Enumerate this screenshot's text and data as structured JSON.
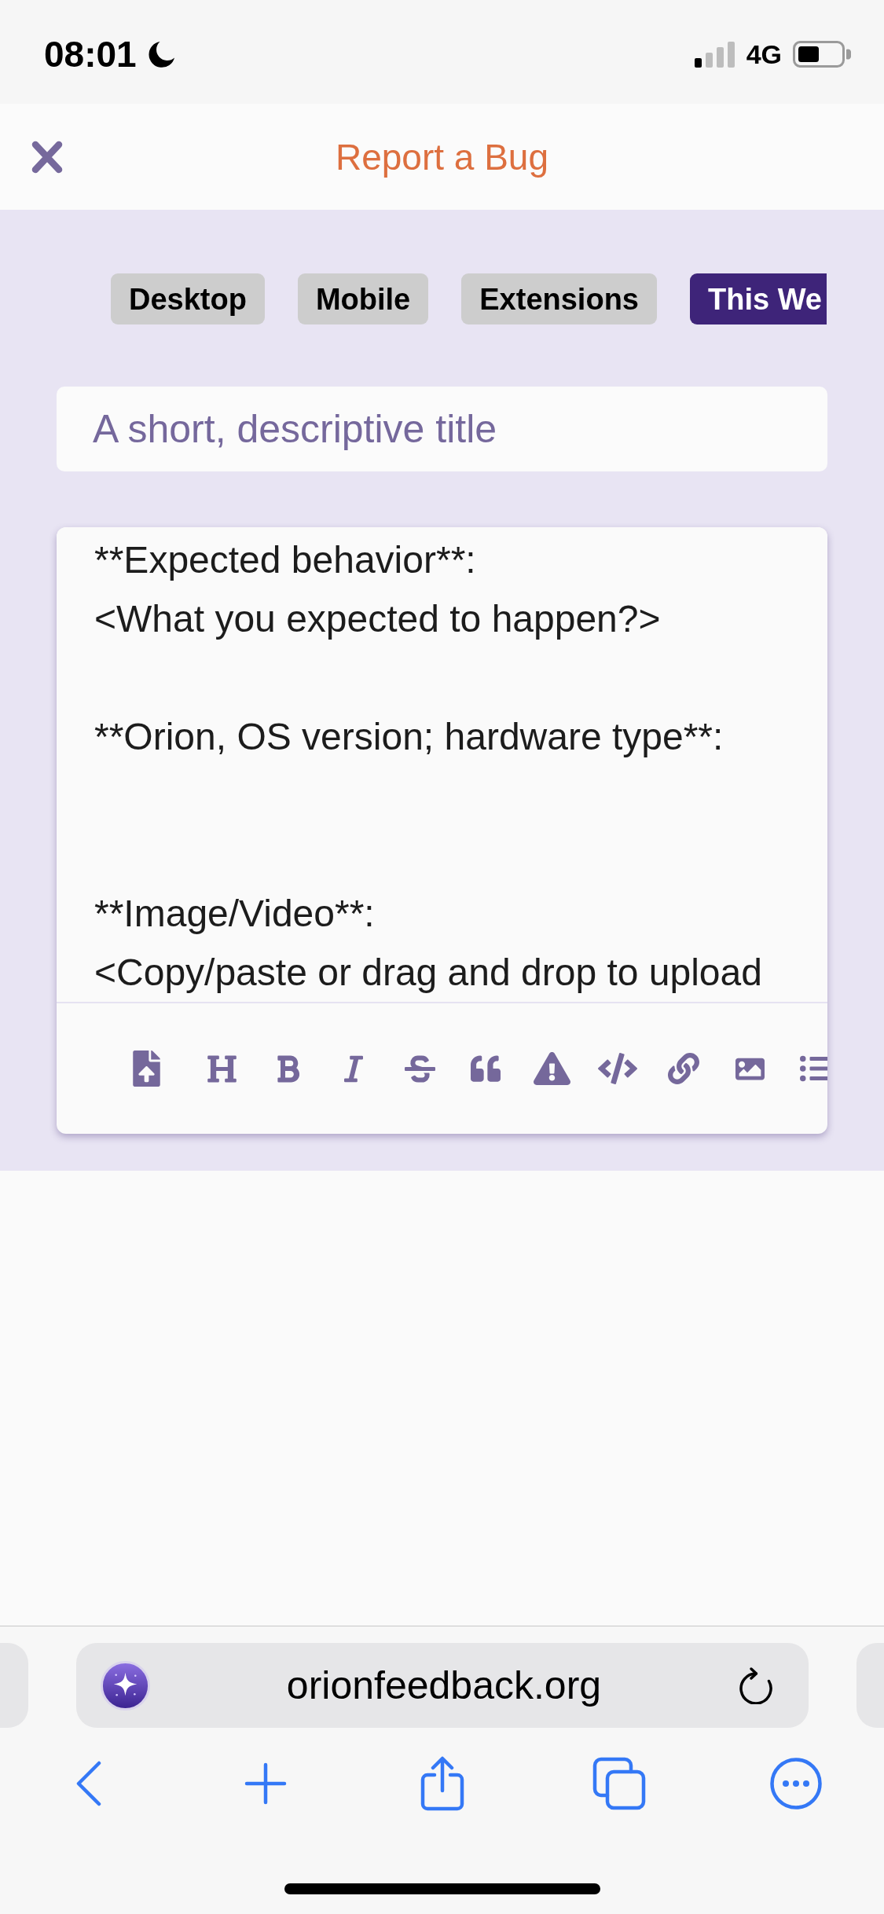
{
  "status_bar": {
    "time": "08:01",
    "network": "4G"
  },
  "header": {
    "title": "Report a Bug"
  },
  "category_tabs": [
    {
      "label": "Desktop",
      "selected": false
    },
    {
      "label": "Mobile",
      "selected": false
    },
    {
      "label": "Extensions",
      "selected": false
    },
    {
      "label": "This We",
      "selected": true
    }
  ],
  "title_field": {
    "placeholder": "A short, descriptive title"
  },
  "description_field": {
    "value": "**Expected behavior**:\n<What you expected to happen?>\n\n**Orion, OS version; hardware type**:\n\n\n**Image/Video**:\n<Copy/paste or drag and drop to upload"
  },
  "address_bar": {
    "url": "orionfeedback.org"
  }
}
